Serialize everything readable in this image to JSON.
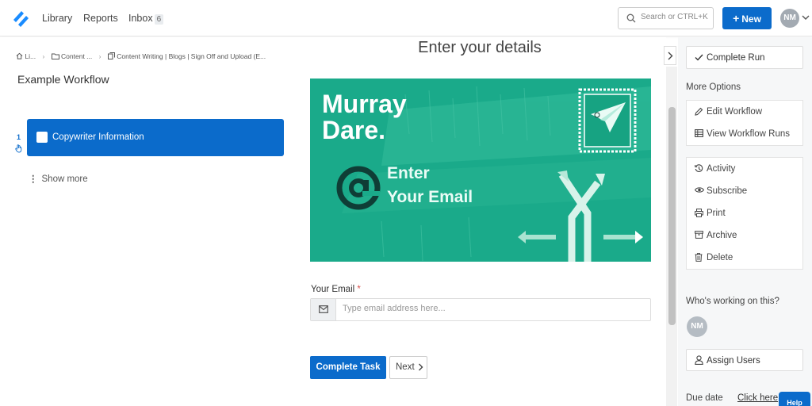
{
  "nav": {
    "links": [
      "Library",
      "Reports",
      "Inbox"
    ],
    "inbox_count": "6",
    "search_placeholder": "Search or CTRL+K",
    "new_label": "New",
    "user_initials": "NM"
  },
  "left": {
    "breadcrumb": [
      "Li...",
      "Content ...",
      "Content Writing | Blogs | Sign Off and Upload (E..."
    ],
    "workflow_title": "Example Workflow",
    "tasks": [
      {
        "number": "1",
        "label": "Copywriter Information"
      }
    ],
    "show_more": "Show more"
  },
  "center": {
    "heading": "Enter your details",
    "banner": {
      "line1": "Murray",
      "line2": "Dare.",
      "cta1": "Enter",
      "cta2": "Your Email",
      "bg": "#1aaa8a"
    },
    "email_label": "Your Email",
    "email_required": "*",
    "email_placeholder": "Type email address here...",
    "complete_task": "Complete Task",
    "next": "Next"
  },
  "right": {
    "complete_run": "Complete Run",
    "more_options": "More Options",
    "group1": [
      "Edit Workflow",
      "View Workflow Runs"
    ],
    "group2": [
      "Activity",
      "Subscribe",
      "Print",
      "Archive",
      "Delete"
    ],
    "who_working": "Who's working on this?",
    "assignee_initials": "NM",
    "assign_users": "Assign Users",
    "due_label": "Due date",
    "due_link": "Click here",
    "help": "Help"
  },
  "colors": {
    "primary": "#0b6bcb",
    "banner_green": "#1aaa8a",
    "banner_dark": "#0f3d36"
  }
}
